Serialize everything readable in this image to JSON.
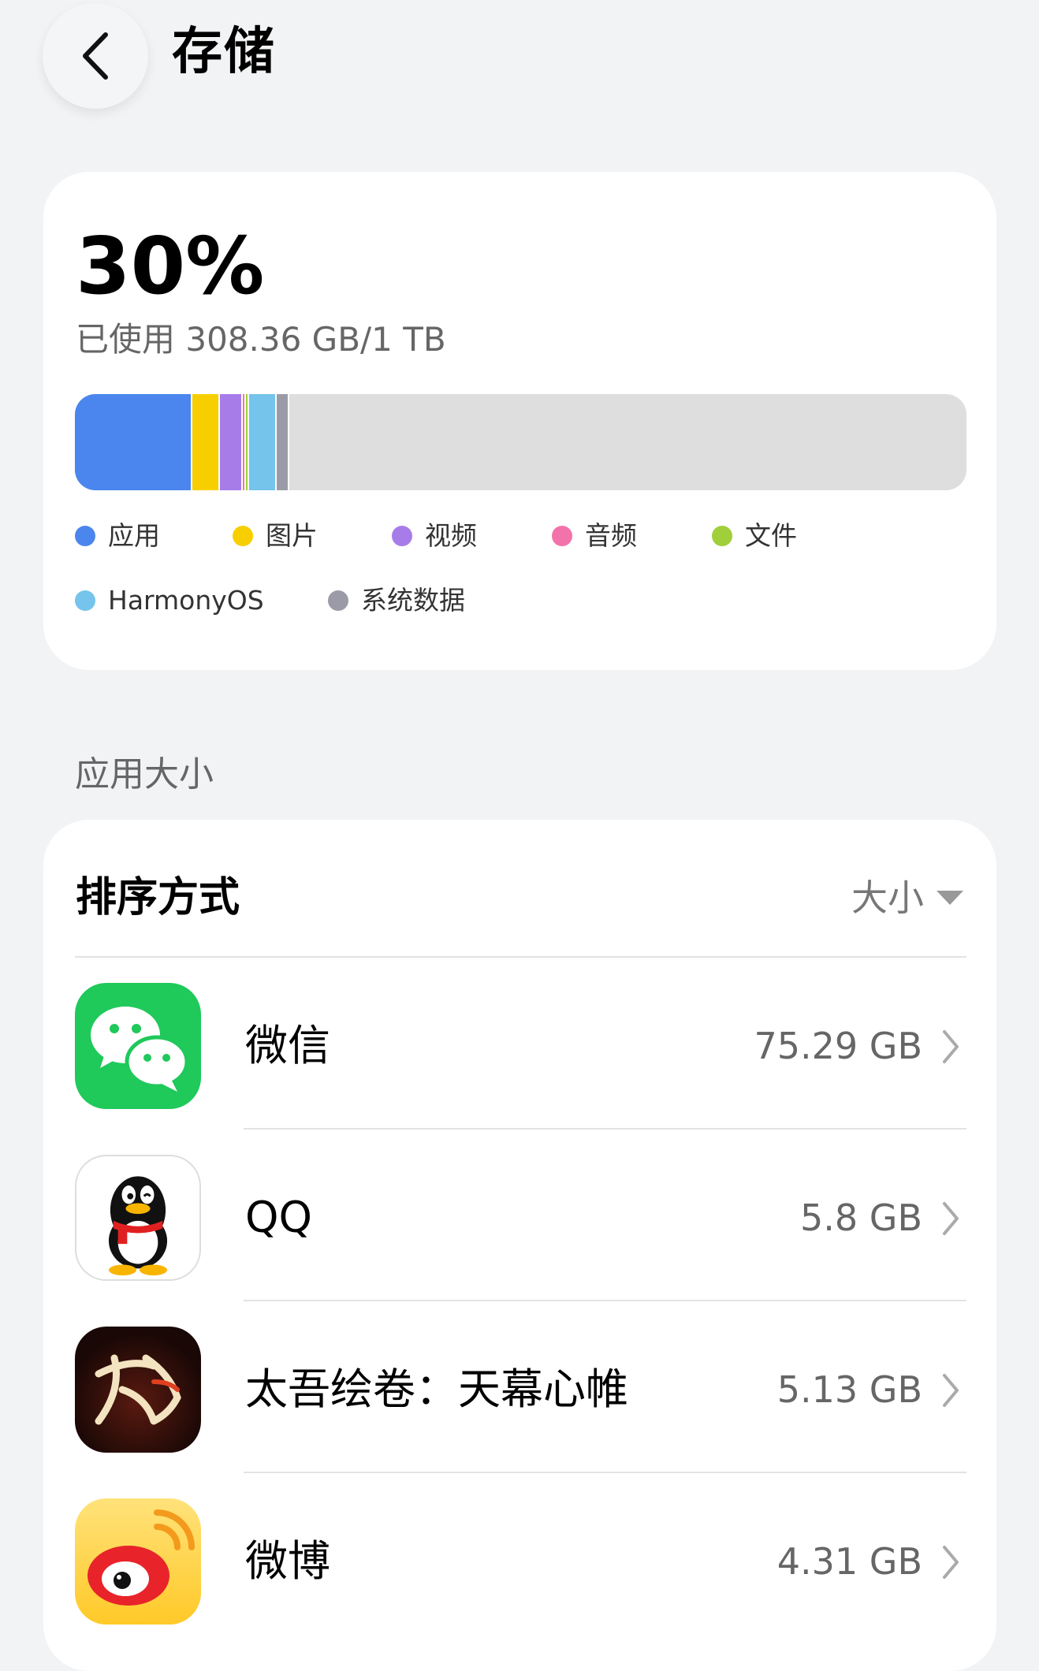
{
  "header": {
    "title": "存储",
    "back_icon": "chevron-left-icon"
  },
  "storage": {
    "percent": "30%",
    "used_text": "已使用 308.36 GB/1 TB",
    "used_fraction": 0.3,
    "segments": [
      {
        "name": "应用",
        "color": "#4a86ed",
        "fraction": 0.13
      },
      {
        "name": "图片",
        "color": "#f7cf00",
        "fraction": 0.029
      },
      {
        "name": "视频",
        "color": "#a77ce9",
        "fraction": 0.024
      },
      {
        "name": "音频",
        "color": "#f173a9",
        "fraction": 0.002
      },
      {
        "name": "文件",
        "color": "#a0cf3b",
        "fraction": 0.002
      },
      {
        "name": "HarmonyOS",
        "color": "#74c4ec",
        "fraction": 0.029
      },
      {
        "name": "系统数据",
        "color": "#9b9ba8",
        "fraction": 0.012
      }
    ]
  },
  "legend": [
    {
      "label": "应用",
      "color": "#4a86ed"
    },
    {
      "label": "图片",
      "color": "#f7cf00"
    },
    {
      "label": "视频",
      "color": "#a77ce9"
    },
    {
      "label": "音频",
      "color": "#f173a9"
    },
    {
      "label": "文件",
      "color": "#a0cf3b"
    },
    {
      "label": "HarmonyOS",
      "color": "#74c4ec"
    },
    {
      "label": "系统数据",
      "color": "#9b9ba8"
    }
  ],
  "apps_section": {
    "title": "应用大小",
    "sort_label": "排序方式",
    "sort_value": "大小",
    "items": [
      {
        "name": "微信",
        "size": "75.29 GB",
        "icon": "wechat-icon"
      },
      {
        "name": "QQ",
        "size": "5.8 GB",
        "icon": "qq-icon"
      },
      {
        "name": "太吾绘卷：天幕心帷",
        "size": "5.13 GB",
        "icon": "taiwu-icon"
      },
      {
        "name": "微博",
        "size": "4.31 GB",
        "icon": "weibo-icon"
      }
    ]
  }
}
